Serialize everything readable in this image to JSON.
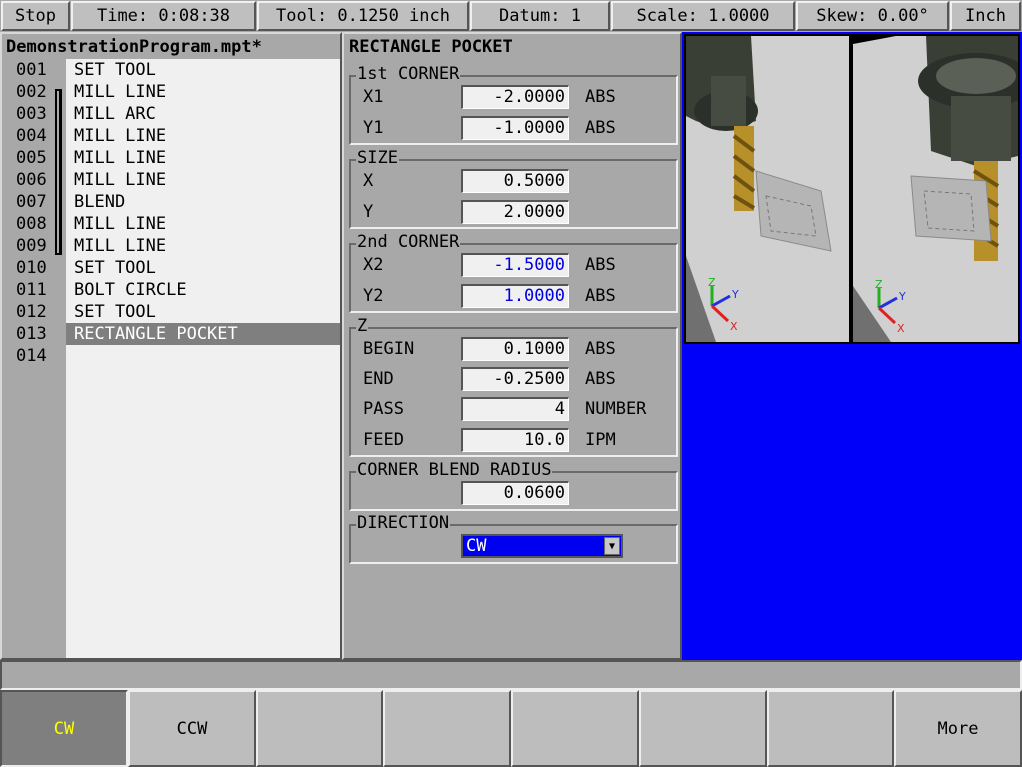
{
  "status": {
    "stop": "Stop",
    "time": "Time: 0:08:38",
    "tool": "Tool: 0.1250 inch",
    "datum": "Datum: 1",
    "scale": "Scale: 1.0000",
    "skew": "Skew: 0.00°",
    "units": "Inch"
  },
  "program": {
    "title": "DemonstrationProgram.mpt*",
    "rows": [
      {
        "num": "001",
        "code": "SET TOOL"
      },
      {
        "num": "002",
        "code": "MILL LINE"
      },
      {
        "num": "003",
        "code": "MILL ARC"
      },
      {
        "num": "004",
        "code": "MILL LINE"
      },
      {
        "num": "005",
        "code": "MILL LINE"
      },
      {
        "num": "006",
        "code": "MILL LINE"
      },
      {
        "num": "007",
        "code": "BLEND"
      },
      {
        "num": "008",
        "code": "MILL LINE"
      },
      {
        "num": "009",
        "code": "MILL LINE"
      },
      {
        "num": "010",
        "code": "SET TOOL"
      },
      {
        "num": "011",
        "code": "BOLT CIRCLE"
      },
      {
        "num": "012",
        "code": "SET TOOL"
      },
      {
        "num": "013",
        "code": "RECTANGLE POCKET"
      },
      {
        "num": "014",
        "code": ""
      }
    ],
    "selected_row": "013"
  },
  "form": {
    "title": "RECTANGLE POCKET",
    "corner1": {
      "label": "1st CORNER",
      "x1": {
        "label": "X1",
        "value": "-2.0000",
        "unit": "ABS"
      },
      "y1": {
        "label": "Y1",
        "value": "-1.0000",
        "unit": "ABS"
      }
    },
    "size": {
      "label": "SIZE",
      "x": {
        "label": "X",
        "value": "0.5000"
      },
      "y": {
        "label": "Y",
        "value": "2.0000"
      }
    },
    "corner2": {
      "label": "2nd CORNER",
      "x2": {
        "label": "X2",
        "value": "-1.5000",
        "unit": "ABS"
      },
      "y2": {
        "label": "Y2",
        "value": "1.0000",
        "unit": "ABS"
      }
    },
    "z": {
      "label": "Z",
      "begin": {
        "label": "BEGIN",
        "value": "0.1000",
        "unit": "ABS"
      },
      "end": {
        "label": "END",
        "value": "-0.2500",
        "unit": "ABS"
      },
      "pass": {
        "label": "PASS",
        "value": "4",
        "unit": "NUMBER"
      },
      "feed": {
        "label": "FEED",
        "value": "10.0",
        "unit": "IPM"
      }
    },
    "blend": {
      "label": "CORNER BLEND RADIUS",
      "value": "0.0600"
    },
    "direction": {
      "label": "DIRECTION",
      "value": "CW"
    }
  },
  "viewport": {
    "axis_x": "X",
    "axis_y": "Y",
    "axis_z": "Z"
  },
  "softkeys": [
    "CW",
    "CCW",
    "",
    "",
    "",
    "",
    "",
    "More"
  ],
  "colors": {
    "panel_bg": "#a8a8a8",
    "graphics_bg": "#0000fa",
    "selected_row_bg": "#7f7f7f",
    "active_softkey_text": "#ffff00",
    "highlight_value": "#0000e0"
  }
}
